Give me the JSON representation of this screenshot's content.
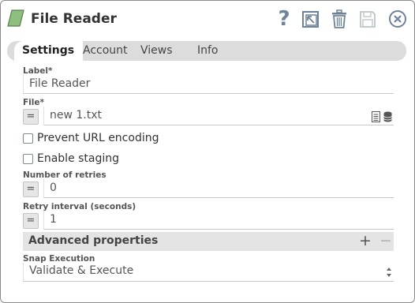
{
  "header": {
    "title": "File Reader",
    "help_label": "?",
    "icons": [
      "snap-icon",
      "help-icon",
      "expand-icon",
      "delete-icon",
      "save-icon",
      "close-icon"
    ]
  },
  "tabs": [
    {
      "label": "Settings",
      "active": true
    },
    {
      "label": "Account",
      "active": false
    },
    {
      "label": "Views",
      "active": false
    },
    {
      "label": "Info",
      "active": false
    }
  ],
  "fields": {
    "label": {
      "title": "Label*",
      "value": "File Reader"
    },
    "file": {
      "title": "File*",
      "value": "new 1.txt",
      "eq": "="
    },
    "prevent_url_encoding": {
      "label": "Prevent URL encoding",
      "checked": false
    },
    "enable_staging": {
      "label": "Enable staging",
      "checked": false
    },
    "retries": {
      "title": "Number of retries",
      "value": "0",
      "eq": "="
    },
    "retry_interval": {
      "title": "Retry interval (seconds)",
      "value": "1",
      "eq": "="
    }
  },
  "advanced": {
    "title": "Advanced properties",
    "plus": "+",
    "minus": "−"
  },
  "snap_execution": {
    "title": "Snap Execution",
    "value": "Validate & Execute"
  },
  "colors": {
    "snap_icon": "#8fbf7f",
    "tab_bar": "#dcdcdc",
    "icon_gray": "#6e8396"
  }
}
